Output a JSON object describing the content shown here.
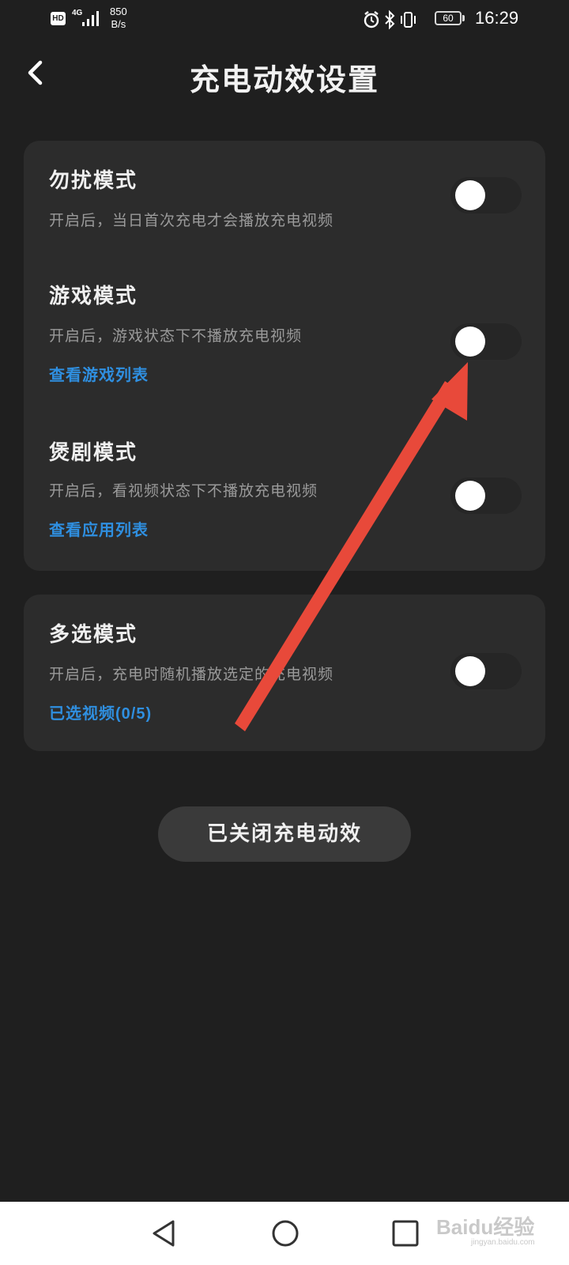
{
  "status_bar": {
    "hd": "HD",
    "network": "4G",
    "speed_value": "850",
    "speed_unit": "B/s",
    "battery": "60",
    "time": "16:29",
    "icons": [
      "alarm-icon",
      "bluetooth-icon",
      "vibrate-icon"
    ]
  },
  "header": {
    "back_icon": "chevron-left-icon",
    "title": "充电动效设置"
  },
  "settings_groups": [
    {
      "items": [
        {
          "title": "勿扰模式",
          "description": "开启后，当日首次充电才会播放充电视频",
          "link": null,
          "enabled": false
        },
        {
          "title": "游戏模式",
          "description": "开启后，游戏状态下不播放充电视频",
          "link": "查看游戏列表",
          "enabled": false
        },
        {
          "title": "煲剧模式",
          "description": "开启后，看视频状态下不播放充电视频",
          "link": "查看应用列表",
          "enabled": false
        }
      ]
    },
    {
      "items": [
        {
          "title": "多选模式",
          "description": "开启后，充电时随机播放选定的充电视频",
          "link": "已选视频(0/5)",
          "enabled": false
        }
      ]
    }
  ],
  "bottom_button": {
    "label": "已关闭充电动效"
  },
  "nav_bar": {
    "icons": [
      "nav-back-icon",
      "nav-home-icon",
      "nav-recent-icon"
    ]
  },
  "watermark": {
    "text": "Baidu经验",
    "sub": "jingyan.baidu.com"
  },
  "colors": {
    "background": "#1f1f1f",
    "card": "#2c2c2c",
    "link": "#2f8fe0",
    "annotation_arrow": "#e8493a"
  }
}
